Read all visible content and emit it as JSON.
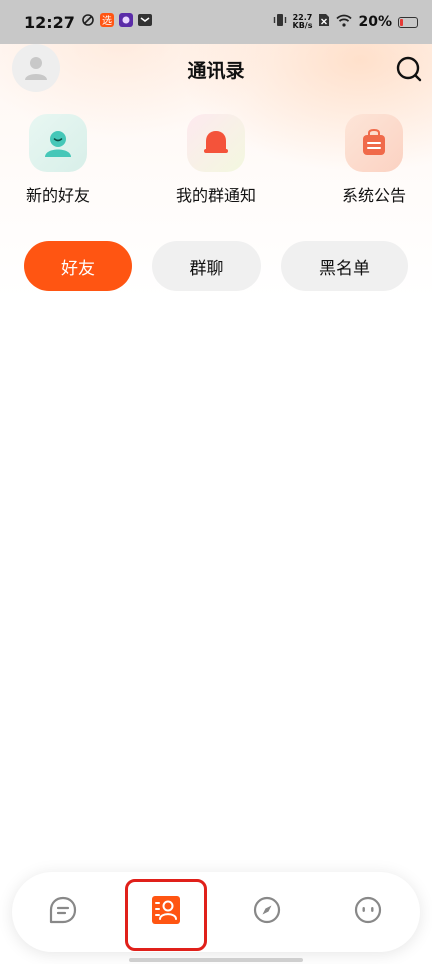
{
  "status_bar": {
    "time": "12:27",
    "net_speed_value": "22.7",
    "net_speed_unit": "KB/s",
    "battery_percent": "20%",
    "battery_level": 0.2
  },
  "header": {
    "title": "通讯录",
    "avatar_icon": "user-avatar-icon",
    "search_icon": "search-icon"
  },
  "shortcuts": [
    {
      "label": "新的好友",
      "icon": "new-friend-icon",
      "color": "#46c7b8"
    },
    {
      "label": "我的群通知",
      "icon": "bell-icon",
      "color": "#f4533a"
    },
    {
      "label": "系统公告",
      "icon": "announcement-bag-icon",
      "color": "#f06a4a"
    }
  ],
  "tabs": [
    {
      "label": "好友",
      "active": true
    },
    {
      "label": "群聊",
      "active": false
    },
    {
      "label": "黑名单",
      "active": false
    }
  ],
  "bottom_nav": [
    {
      "name": "messages",
      "icon": "chat-bubble-icon",
      "active": false
    },
    {
      "name": "contacts",
      "icon": "contacts-icon",
      "active": true
    },
    {
      "name": "discover",
      "icon": "compass-icon",
      "active": false
    },
    {
      "name": "me",
      "icon": "face-icon",
      "active": false
    }
  ],
  "colors": {
    "accent": "#ff5512",
    "highlight_border": "#e0201a"
  }
}
